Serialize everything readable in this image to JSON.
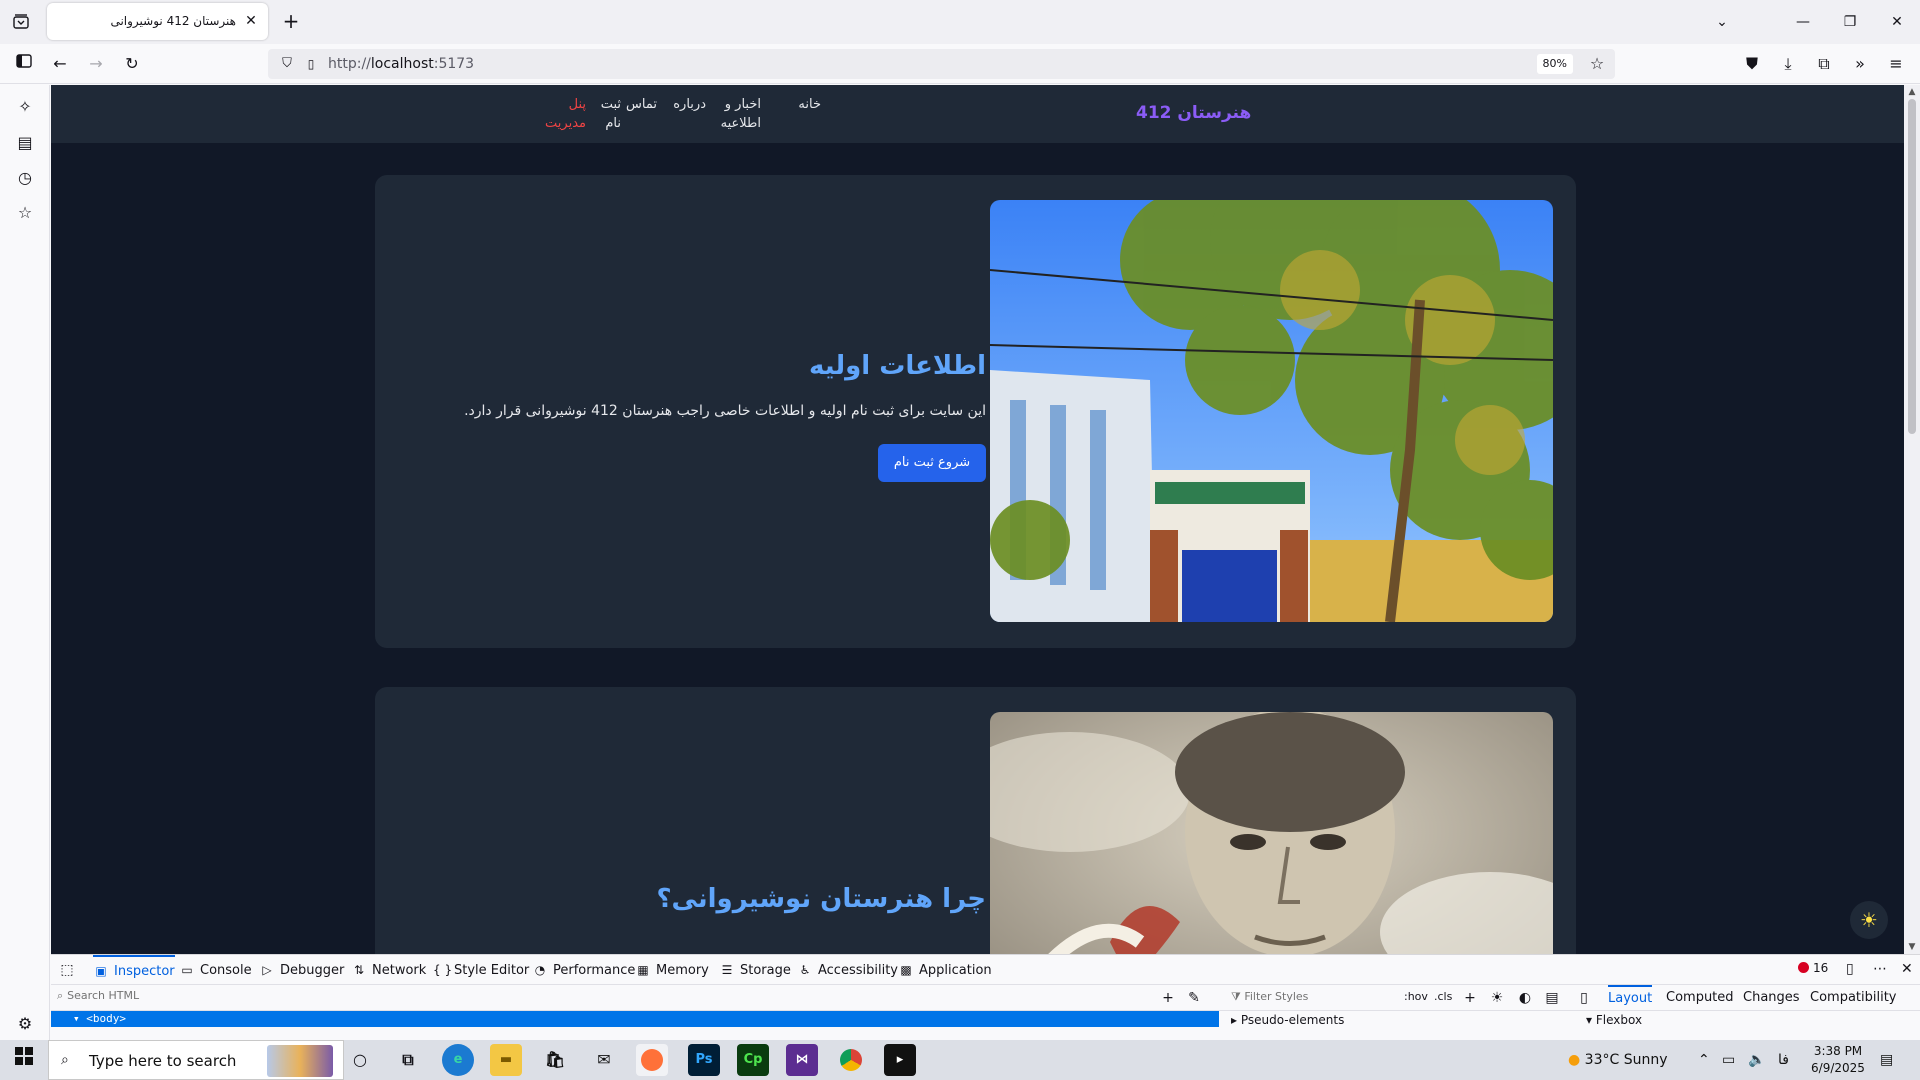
{
  "browser": {
    "tab_title": "هنرستان 412 نوشیروانی",
    "tab_close": "✕",
    "new_tab": "+",
    "url_prefix": "http://",
    "url_host": "localhost",
    "url_port": ":5173",
    "zoom": "80%"
  },
  "site": {
    "brand": "هنرستان 412",
    "nav": {
      "home": "خانه",
      "news_line1": "اخبار و",
      "news_line2": "اطلاعیه",
      "about": "درباره",
      "contact": "تماس",
      "register_line1": "ثبت",
      "register_line2": "نام",
      "admin_line1": "پنل",
      "admin_line2": "مدیریت"
    },
    "card1": {
      "title": "اطلاعات اولیه",
      "text": "این سایت برای ثبت نام اولیه و اطلاعات خاصی راجب هنرستان 412 نوشیروانی قرار دارد.",
      "button": "شروع ثبت نام",
      "image": "school-building-photo"
    },
    "card2": {
      "title": "چرا هنرستان نوشیروانی؟",
      "image": "portrait-photo"
    }
  },
  "devtools": {
    "tabs": [
      "Inspector",
      "Console",
      "Debugger",
      "Network",
      "Style Editor",
      "Performance",
      "Memory",
      "Storage",
      "Accessibility",
      "Application"
    ],
    "error_count": "16",
    "search_placeholder": "Search HTML",
    "filter_placeholder": "Filter Styles",
    "hov": ":hov",
    "cls": ".cls",
    "side_tabs": [
      "Layout",
      "Computed",
      "Changes",
      "Compatibility"
    ],
    "selected_node": "<body>",
    "pseudo_elements": "Pseudo-elements",
    "flexbox": "Flexbox"
  },
  "taskbar": {
    "search_placeholder": "Type here to search",
    "weather": "33°C  Sunny",
    "lang": "فا",
    "time": "3:38 PM",
    "date": "6/9/2025"
  },
  "colors": {
    "page_bg": "#111827",
    "card_bg": "#1f2937",
    "brand": "#8b5cf6",
    "heading": "#60a5fa",
    "button": "#2563eb",
    "admin": "#ef4444"
  }
}
